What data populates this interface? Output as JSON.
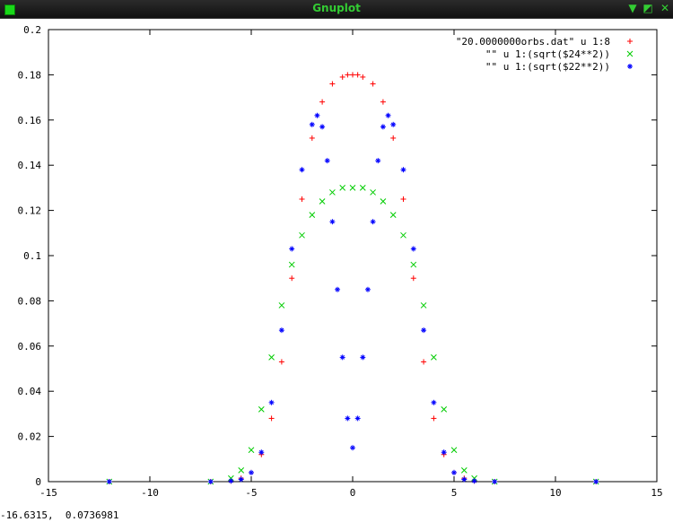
{
  "window": {
    "title": "Gnuplot"
  },
  "titlebar_buttons": {
    "minimize": "▼",
    "maximize": "◩",
    "close": "✕"
  },
  "status": {
    "coordinates": "-16.6315,  0.0736981"
  },
  "colors": {
    "series1": "#ff0000",
    "series2": "#00cc00",
    "series3": "#0000ff"
  },
  "chart_data": {
    "type": "scatter",
    "xlim": [
      -15,
      15
    ],
    "ylim": [
      0,
      0.2
    ],
    "xticks": [
      -15,
      -10,
      -5,
      0,
      5,
      10,
      15
    ],
    "yticks": [
      0,
      0.02,
      0.04,
      0.06,
      0.08,
      0.1,
      0.12,
      0.14,
      0.16,
      0.18,
      0.2
    ],
    "ytick_labels": [
      "0",
      "0.02",
      "0.04",
      "0.06",
      "0.08",
      "0.1",
      "0.12",
      "0.14",
      "0.16",
      "0.18",
      "0.2"
    ],
    "grid": false,
    "legend_position": "top-right",
    "series": [
      {
        "name": "\"20.0000000orbs.dat\" u 1:8",
        "marker": "+",
        "color": "#ff0000",
        "x": [
          -12,
          -7,
          -6,
          -5.5,
          -5,
          -4.5,
          -4,
          -3.5,
          -3,
          -2.5,
          -2,
          -1.5,
          -1,
          -0.5,
          -0.25,
          0,
          0.25,
          0.5,
          1,
          1.5,
          2,
          2.5,
          3,
          3.5,
          4,
          4.5,
          5,
          5.5,
          6,
          7,
          12
        ],
        "y": [
          0,
          0,
          0.0003,
          0.0015,
          0.004,
          0.012,
          0.028,
          0.053,
          0.09,
          0.125,
          0.152,
          0.168,
          0.176,
          0.179,
          0.18,
          0.18,
          0.18,
          0.179,
          0.176,
          0.168,
          0.152,
          0.125,
          0.09,
          0.053,
          0.028,
          0.012,
          0.004,
          0.0015,
          0.0003,
          0,
          0
        ]
      },
      {
        "name": "\"\" u 1:(sqrt($24**2))",
        "marker": "x",
        "color": "#00cc00",
        "x": [
          -12,
          -7,
          -6,
          -5.5,
          -5,
          -4.5,
          -4,
          -3.5,
          -3,
          -2.5,
          -2,
          -1.5,
          -1,
          -0.5,
          0,
          0.5,
          1,
          1.5,
          2,
          2.5,
          3,
          3.5,
          4,
          4.5,
          5,
          5.5,
          6,
          7,
          12
        ],
        "y": [
          0,
          0,
          0.0015,
          0.005,
          0.014,
          0.032,
          0.055,
          0.078,
          0.096,
          0.109,
          0.118,
          0.124,
          0.128,
          0.13,
          0.13,
          0.13,
          0.128,
          0.124,
          0.118,
          0.109,
          0.096,
          0.078,
          0.055,
          0.032,
          0.014,
          0.005,
          0.0015,
          0,
          0
        ]
      },
      {
        "name": "\"\" u 1:(sqrt($22**2))",
        "marker": "*",
        "color": "#0000ff",
        "x": [
          -12,
          -7,
          -6,
          -5.5,
          -5,
          -4.5,
          -4,
          -3.5,
          -3,
          -2.5,
          -2,
          -1.75,
          -1.5,
          -1.25,
          -1,
          -0.75,
          -0.5,
          -0.25,
          0,
          0.25,
          0.5,
          0.75,
          1,
          1.25,
          1.5,
          1.75,
          2,
          2.5,
          3,
          3.5,
          4,
          4.5,
          5,
          5.5,
          6,
          7,
          12
        ],
        "y": [
          0,
          0,
          0.0003,
          0.001,
          0.004,
          0.013,
          0.035,
          0.067,
          0.103,
          0.138,
          0.158,
          0.162,
          0.157,
          0.142,
          0.115,
          0.085,
          0.055,
          0.028,
          0.015,
          0.028,
          0.055,
          0.085,
          0.115,
          0.142,
          0.157,
          0.162,
          0.158,
          0.138,
          0.103,
          0.067,
          0.035,
          0.013,
          0.004,
          0.001,
          0.0003,
          0,
          0
        ]
      }
    ]
  }
}
